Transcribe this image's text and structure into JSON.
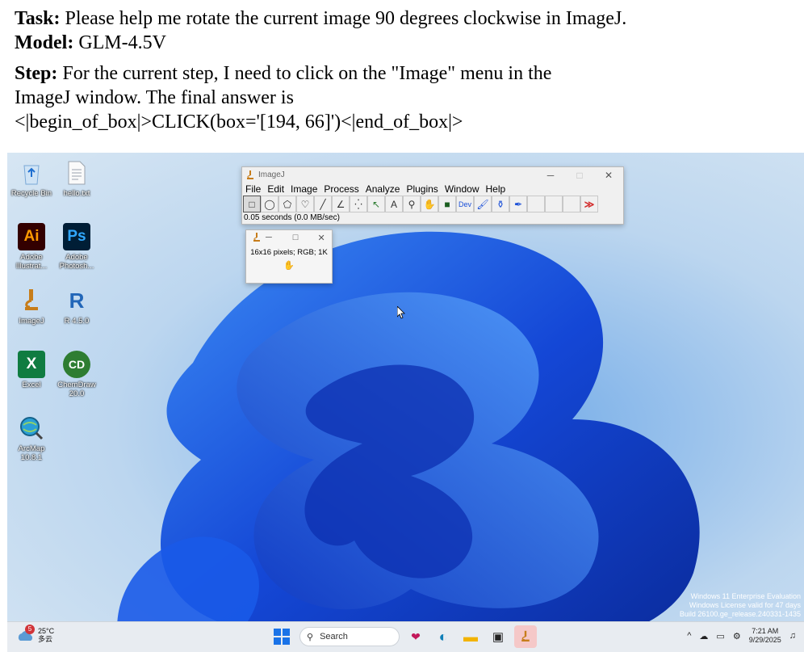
{
  "caption": {
    "task_label": "Task:",
    "task_text": " Please help me rotate the current image 90 degrees clockwise in ImageJ.",
    "model_label": "Model:",
    "model_text": " GLM-4.5V",
    "step_label": "Step:",
    "step_text_1": " For the current step, I need to click on the \"Image\" menu in the",
    "step_text_2": "ImageJ window. The final answer is",
    "step_text_3": "<|begin_of_box|>CLICK(box='[194, 66]')<|end_of_box|>"
  },
  "desktop_icons": [
    {
      "label": "Recycle Bin",
      "icon": "recycle-bin-icon"
    },
    {
      "label": "hello.txt",
      "icon": "text-file-icon"
    },
    {
      "label": "Adobe Illustrat...",
      "glyph": "Ai",
      "color": "#300a00",
      "fg": "#ff9a00"
    },
    {
      "label": "Adobe Photosh...",
      "glyph": "Ps",
      "color": "#001e36",
      "fg": "#31a8ff"
    },
    {
      "label": "ImageJ",
      "icon": "microscope-icon"
    },
    {
      "label": "R 4.5.0",
      "glyph": "R",
      "color": "#2266b8"
    },
    {
      "label": "Excel",
      "glyph": "X",
      "color": "#107c41"
    },
    {
      "label": "ChemDraw 20.0",
      "glyph": "CD",
      "color": "#2e7d32"
    },
    {
      "label": "ArcMap 10.8.1",
      "icon": "globe-icon"
    }
  ],
  "imagej_main": {
    "title": "ImageJ",
    "menu": [
      "File",
      "Edit",
      "Image",
      "Process",
      "Analyze",
      "Plugins",
      "Window",
      "Help"
    ],
    "tools": [
      "□",
      "◯",
      "⬠",
      "♡",
      "╱",
      "∠",
      "⁛",
      "↖",
      "A",
      "⚲",
      "✋",
      "■",
      "Dev",
      "🖌",
      "⚱",
      "✒",
      "",
      "",
      "",
      "≫"
    ],
    "status": "0.05 seconds (0.0 MB/sec)"
  },
  "imagej_image": {
    "info": "16x16 pixels; RGB; 1K"
  },
  "watermark": {
    "line1": "Windows 11 Enterprise Evaluation",
    "line2": "Windows License valid for 47 days",
    "line3": "Build 26100.ge_release.240331-1435"
  },
  "taskbar": {
    "weather_temp": "25°C",
    "weather_desc": "多云",
    "weather_badge": "5",
    "search_placeholder": "Search",
    "time": "7:21 AM",
    "date": "9/29/2025"
  },
  "colors": {
    "accent": "#1a73e8",
    "wallpaper_blue": "#1a4fd8"
  }
}
